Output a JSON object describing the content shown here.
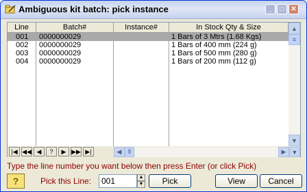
{
  "window": {
    "title": "Ambiguous kit batch: pick instance"
  },
  "table": {
    "columns": [
      "Line",
      "Batch#",
      "Instance#",
      "In Stock Qty & Size"
    ],
    "rows": [
      {
        "line": "001",
        "batch": "0000000029",
        "instance": "",
        "stock": "1 Bars of 3 Mtrs (1.68 Kgs)"
      },
      {
        "line": "002",
        "batch": "0000000029",
        "instance": "",
        "stock": "1 Bars of 400 mm (224 g)"
      },
      {
        "line": "003",
        "batch": "0000000029",
        "instance": "",
        "stock": "1 Bars of 500 mm (280 g)"
      },
      {
        "line": "004",
        "batch": "0000000029",
        "instance": "",
        "stock": "1 Bars of 200 mm (112 g)"
      }
    ],
    "selected_row": 0
  },
  "nav": [
    "|◀",
    "◀◀",
    "◀",
    "?",
    "▶",
    "▶▶",
    "▶|"
  ],
  "hint": "Type the line number you want below then press Enter (or click Pick)",
  "pick": {
    "label": "Pick this Line:",
    "value": "001",
    "button": "Pick"
  },
  "buttons": {
    "view": "View",
    "cancel": "Cancel",
    "help": "?"
  },
  "colors": {
    "selected": "#a9a9a9",
    "hint_text": "#8b0000",
    "title_bar": "#c4d3f0"
  }
}
